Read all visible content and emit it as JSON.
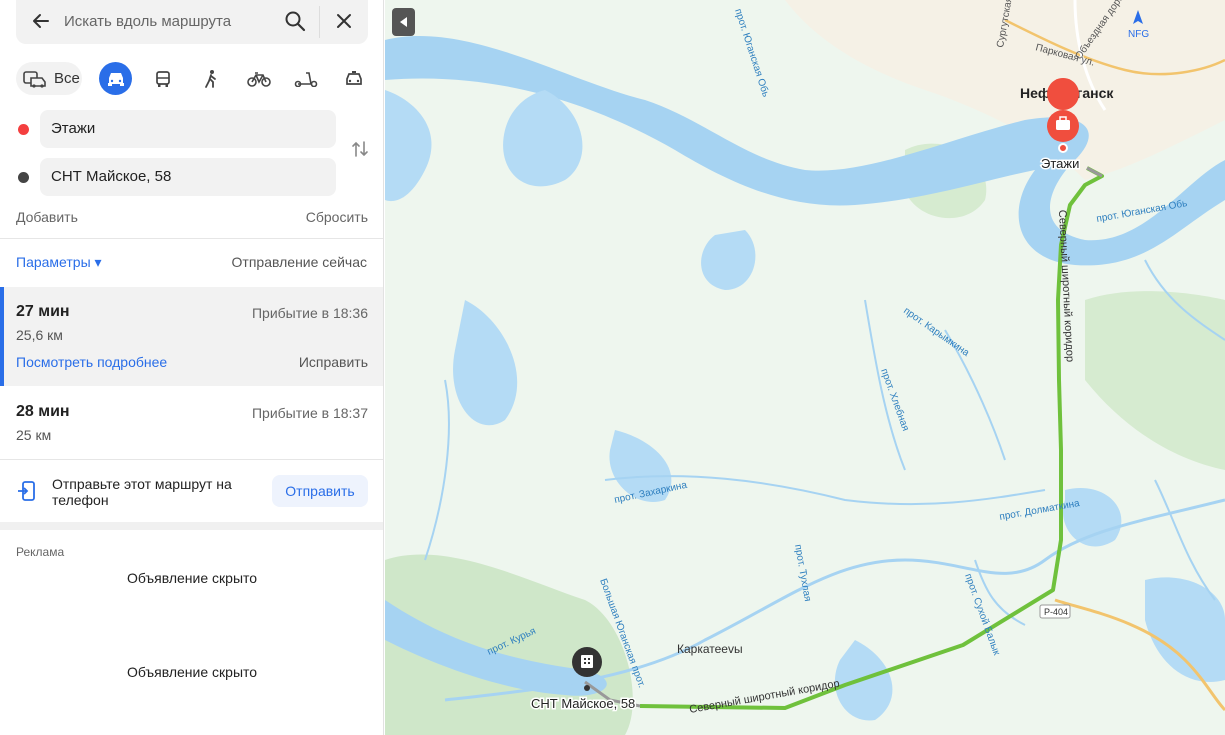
{
  "search": {
    "placeholder": "Искать вдоль маршрута"
  },
  "modes": {
    "all_label": "Все"
  },
  "waypoints": {
    "from": "Этажи",
    "to": "СНТ Майское, 58"
  },
  "actions": {
    "add": "Добавить",
    "reset": "Сбросить"
  },
  "params": {
    "label": "Параметры ▾",
    "departure": "Отправление сейчас"
  },
  "routes": [
    {
      "time": "27 мин",
      "distance": "25,6 км",
      "arrival": "Прибытие в 18:36",
      "details": "Посмотреть подробнее",
      "fix": "Исправить"
    },
    {
      "time": "28 мин",
      "distance": "25 км",
      "arrival": "Прибытие в 18:37"
    }
  ],
  "send": {
    "text": "Отправьте этот маршрут на телефон",
    "button": "Отправить"
  },
  "ads": {
    "label": "Реклама",
    "hidden1": "Объявление скрыто",
    "hidden2": "Объявление скрыто"
  },
  "map": {
    "city": "Нефтеюганск",
    "start_label": "Этажи",
    "end_label": "СНТ Майское, 58",
    "village": "Каркатееvы",
    "airport": "NFG",
    "road_badge": "Р-404",
    "labels": {
      "sever_road_v": "Северный широтный коридор",
      "sever_road_h": "Северный широтный коридор",
      "yugan_ob_n": "прот. Юганская Обь",
      "yugan_ob_e": "прот. Юганская Обь",
      "karymkina": "прот. Карымкина",
      "khlebnaya": "прот. Хлебная",
      "zakharkina": "прот. Захаркина",
      "tukhlaya": "прот. Тухлая",
      "dolmatkina": "прот. Долматкина",
      "sukhoy_balyk": "прот. Сухой Балык",
      "kurya": "прот. Курья",
      "bolshaya_yugan": "Большая Юганская прот.",
      "objezdnaya": "Объездная дорога",
      "parkovaya": "Парковая ул.",
      "surgut": "Сургутская ул."
    },
    "colors": {
      "water": "#a6d3f2",
      "land": "#eef6ee",
      "forest": "#cfe7c9",
      "route": "#6fc13c",
      "marker": "#f04e3e"
    }
  }
}
